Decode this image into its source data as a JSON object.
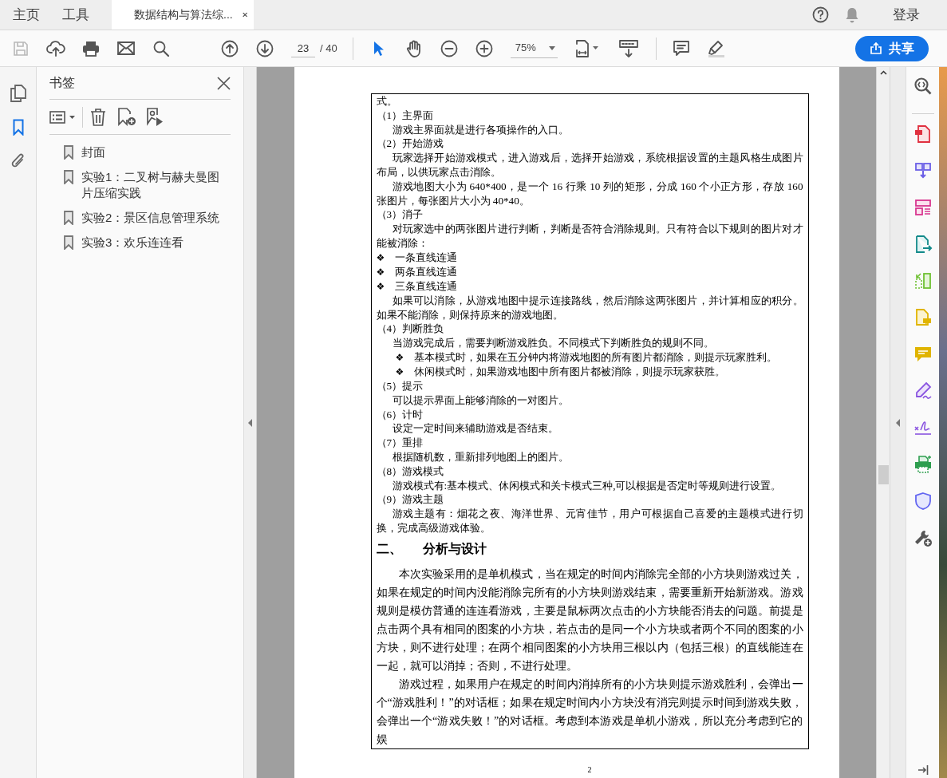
{
  "tabs": [
    {
      "kind": "nav",
      "label": "主页",
      "selected": false
    },
    {
      "kind": "nav",
      "label": "工具",
      "selected": false
    },
    {
      "kind": "document",
      "label": "数据结构与算法综...",
      "selected": true
    }
  ],
  "header": {
    "login": "登录"
  },
  "toolbar": {
    "page_current": "23",
    "page_total": "/ 40",
    "zoom": "75%",
    "share": "共享"
  },
  "left_rail": [
    {
      "kind": "pages",
      "selected": false
    },
    {
      "kind": "bookmarks",
      "selected": true
    },
    {
      "kind": "attachments",
      "selected": false
    }
  ],
  "bookmarks_panel": {
    "title": "书签",
    "items": [
      {
        "label": "封面"
      },
      {
        "label": "实验1：二叉树与赫夫曼图片压缩实践"
      },
      {
        "label": "实验2：景区信息管理系统"
      },
      {
        "label": "实验3：欢乐连连看"
      }
    ]
  },
  "document": {
    "blocks": [
      {
        "kind": "cont",
        "text": "式。"
      },
      {
        "kind": "heading",
        "text": "（1）主界面"
      },
      {
        "kind": "para",
        "text": "游戏主界面就是进行各项操作的入口。"
      },
      {
        "kind": "heading",
        "text": "（2）开始游戏"
      },
      {
        "kind": "para",
        "text": "玩家选择开始游戏模式，进入游戏后，选择开始游戏，系统根据设置的主题风格生成图片布局，以供玩家点击消除。"
      },
      {
        "kind": "para",
        "text": "游戏地图大小为 640*400，是一个 16 行乘 10 列的矩形，分成 160 个小正方形，存放 160 张图片，每张图片大小为 40*40。"
      },
      {
        "kind": "heading",
        "text": "（3）消子"
      },
      {
        "kind": "para",
        "text": "对玩家选中的两张图片进行判断，判断是否符合消除规则。只有符合以下规则的图片对才能被消除："
      },
      {
        "kind": "bullet",
        "marker": "❖",
        "text": "一条直线连通"
      },
      {
        "kind": "bullet",
        "marker": "❖",
        "text": "两条直线连通"
      },
      {
        "kind": "bullet",
        "marker": "❖",
        "text": "三条直线连通"
      },
      {
        "kind": "para",
        "text": "如果可以消除，从游戏地图中提示连接路线，然后消除这两张图片，并计算相应的积分。如果不能消除，则保持原来的游戏地图。"
      },
      {
        "kind": "heading",
        "text": "（4）判断胜负"
      },
      {
        "kind": "para",
        "text": "当游戏完成后，需要判断游戏胜负。不同模式下判断胜负的规则不同。"
      },
      {
        "kind": "subbullet",
        "marker": "❖",
        "text": "基本模式时，如果在五分钟内将游戏地图的所有图片都消除，则提示玩家胜利。"
      },
      {
        "kind": "subbullet",
        "marker": "❖",
        "text": "休闲模式时，如果游戏地图中所有图片都被消除，则提示玩家获胜。"
      },
      {
        "kind": "heading",
        "text": "（5）提示"
      },
      {
        "kind": "para",
        "text": "可以提示界面上能够消除的一对图片。"
      },
      {
        "kind": "heading",
        "text": "（6）计时"
      },
      {
        "kind": "para",
        "text": "设定一定时间来辅助游戏是否结束。"
      },
      {
        "kind": "heading",
        "text": "（7）重排"
      },
      {
        "kind": "para",
        "text": "根据随机数，重新排列地图上的图片。"
      },
      {
        "kind": "heading",
        "text": "（8）游戏模式"
      },
      {
        "kind": "para",
        "text": "游戏模式有:基本模式、休闲模式和关卡模式三种,可以根据是否定时等规则进行设置。"
      },
      {
        "kind": "heading",
        "text": "（9）游戏主题"
      },
      {
        "kind": "para",
        "text": "游戏主题有：烟花之夜、海洋世界、元宵佳节，用户可根据自己喜爱的主题模式进行切换，完成高级游戏体验。"
      },
      {
        "kind": "section",
        "number": "二、",
        "text": "分析与设计"
      },
      {
        "kind": "body",
        "text": "本次实验采用的是单机模式，当在规定的时间内消除完全部的小方块则游戏过关，如果在规定的时间内没能消除完所有的小方块则游戏结束，需要重新开始新游戏。游戏规则是模仿普通的连连看游戏，主要是鼠标两次点击的小方块能否消去的问题。前提是点击两个具有相同的图案的小方块，若点击的是同一个小方块或者两个不同的图案的小方块，则不进行处理；在两个相同图案的小方块用三根以内（包括三根）的直线能连在一起，就可以消掉；否则，不进行处理。"
      },
      {
        "kind": "body",
        "text": "游戏过程，如果用户在规定的时间内消掉所有的小方块则提示游戏胜利，会弹出一个“游戏胜利！”的对话框；如果在规定时间内小方块没有消完则提示时间到游戏失败，会弹出一个“游戏失败！”的对话框。考虑到本游戏是单机小游戏，所以充分考虑到它的娱"
      }
    ],
    "page_number": "2"
  }
}
